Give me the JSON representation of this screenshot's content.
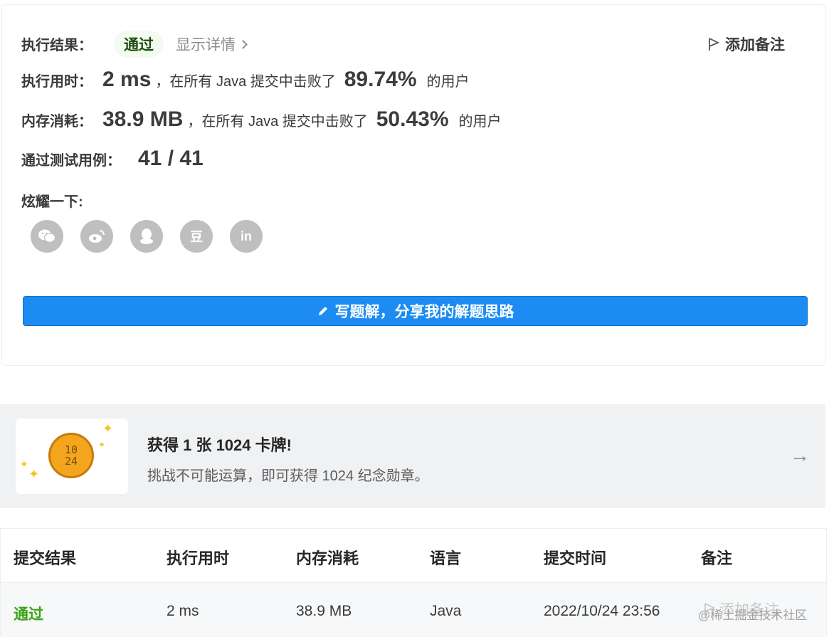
{
  "result": {
    "label": "执行结果：",
    "status": "通过",
    "details_link": "显示详情",
    "add_note": "添加备注"
  },
  "runtime": {
    "label": "执行用时：",
    "value": "2 ms",
    "prefix": "，在所有 Java 提交中击败了",
    "percent": "89.74%",
    "suffix": "的用户"
  },
  "memory": {
    "label": "内存消耗：",
    "value": "38.9 MB",
    "prefix": "，在所有 Java 提交中击败了",
    "percent": "50.43%",
    "suffix": "的用户"
  },
  "tests": {
    "label": "通过测试用例：",
    "value": "41 / 41"
  },
  "share": {
    "label": "炫耀一下:",
    "icons": [
      "wechat-icon",
      "weibo-icon",
      "qq-icon",
      "douban-icon",
      "linkedin-icon"
    ],
    "douban_glyph": "豆",
    "linkedin_glyph": "in"
  },
  "write_button": "写题解，分享我的解题思路",
  "promo": {
    "title": "获得 1 张 1024 卡牌!",
    "subtitle": "挑战不可能运算，即可获得 1024 纪念勋章。",
    "coin_top": "10",
    "coin_bottom": "24",
    "arrow": "→"
  },
  "table": {
    "headers": [
      "提交结果",
      "执行用时",
      "内存消耗",
      "语言",
      "提交时间",
      "备注"
    ],
    "row": {
      "result": "通过",
      "runtime": "2 ms",
      "memory": "38.9 MB",
      "language": "Java",
      "time": "2022/10/24 23:56",
      "note": "添加备注"
    }
  },
  "watermark": "@稀土掘金技术社区",
  "colors": {
    "accent": "#1c8cf2",
    "pass_green": "#3aa315",
    "icon_grey": "#bfbfbf"
  }
}
